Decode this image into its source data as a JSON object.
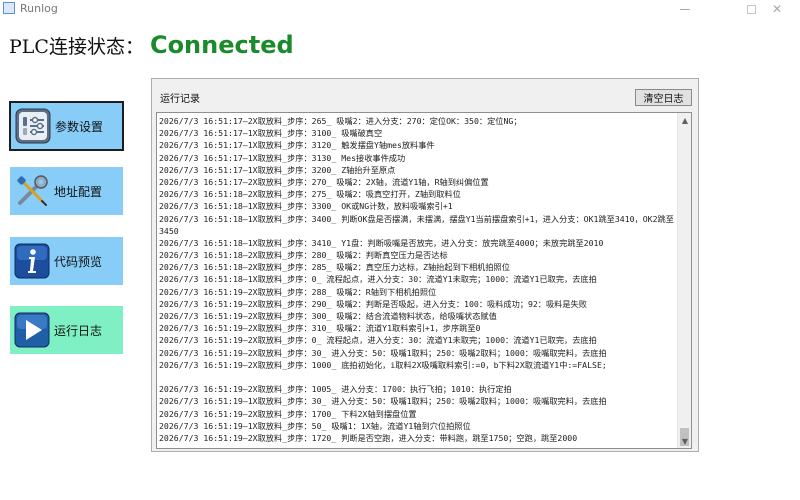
{
  "window": {
    "title": "Runlog",
    "minimize_glyph": "minimize-icon",
    "maximize_glyph": "maximize-icon",
    "close_glyph": "✕"
  },
  "plc": {
    "label": "PLC连接状态：",
    "status": "Connected",
    "status_color": "#1a8a2a"
  },
  "sidebar": {
    "items": [
      {
        "label": "参数设置",
        "icon": "settings-sliders-icon",
        "color": "#87cdf7",
        "active": true
      },
      {
        "label": "地址配置",
        "icon": "wrench-screwdriver-icon",
        "color": "#87cdf7",
        "active": false
      },
      {
        "label": "代码预览",
        "icon": "info-icon",
        "color": "#87cdf7",
        "active": false
      },
      {
        "label": "运行日志",
        "icon": "play-icon",
        "color": "#7ff0c4",
        "active": false
      }
    ]
  },
  "log": {
    "title": "运行记录",
    "clear_button": "清空日志",
    "scroll_up": "▲",
    "scroll_down": "▼",
    "lines": [
      "2026/7/3 16:51:17—2X取放料_步序：265_ 吸嘴2：进入分支：270：定位OK：350：定位NG；",
      "2026/7/3 16:51:17—1X取放料_步序：3100_ 吸嘴破真空",
      "2026/7/3 16:51:17—1X取放料_步序：3120_ 触发摆盘Y轴mes放料事件",
      "2026/7/3 16:51:17—1X取放料_步序：3130_ Mes接收事件成功",
      "2026/7/3 16:51:17—1X取放料_步序：3200_ Z轴抬升至原点",
      "2026/7/3 16:51:17—2X取放料_步序：270_ 吸嘴2：2X轴，流道Y1轴，R轴到纠偏位置",
      "2026/7/3 16:51:18—2X取放料_步序：275_ 吸嘴2：吸真空打开，Z轴到取料位",
      "2026/7/3 16:51:18—1X取放料_步序：3300_ OK或NG计数，放料吸嘴索引+1",
      "2026/7/3 16:51:18—1X取放料_步序：3400_ 判断OK盘是否摆满，未摆满，摆盘Y1当前摆盘索引+1，进入分支：OK1跳至3410，OK2跳至3450",
      "2026/7/3 16:51:18—1X取放料_步序：3410_ Y1盘：判断吸嘴是否放完，进入分支：放完跳至4000；未放完跳至2010",
      "2026/7/3 16:51:18—2X取放料_步序：280_ 吸嘴2：判断真空压力是否达标",
      "2026/7/3 16:51:18—2X取放料_步序：285_ 吸嘴2：真空压力达标，Z轴抬起到下相机拍照位",
      "2026/7/3 16:51:18—1X取放料_步序：0_ 流程起点，进入分支：30：流道Y1未取完；1000：流道Y1已取完，去底拍",
      "2026/7/3 16:51:19—2X取放料_步序：288_ 吸嘴2：R轴到下相机拍照位",
      "2026/7/3 16:51:19—2X取放料_步序：290_ 吸嘴2：判断是否吸起，进入分支：100：吸料成功；92：吸料是失败",
      "2026/7/3 16:51:19—2X取放料_步序：300_ 吸嘴2：结合流道物料状态，给吸嘴状态赋值",
      "2026/7/3 16:51:19—2X取放料_步序：310_ 吸嘴2：流道Y1取料索引+1，步序跳至0",
      "2026/7/3 16:51:19—2X取放料_步序：0_ 流程起点，进入分支：30：流道Y1未取完；1000：流道Y1已取完，去底拍",
      "2026/7/3 16:51:19—2X取放料_步序：30_ 进入分支：50：吸嘴1取料；250：吸嘴2取料；1000：吸嘴取完料，去底拍",
      "2026/7/3 16:51:19—2X取放料_步序：1000_ 底拍初始化，i取料2X吸嘴取料索引:=0，b下料2X取流道Y1中:=FALSE;",
      "2026/7/3 16:51:19—2X取放料_步序：1005_ 进入分支：1700：执行飞拍；1010：执行定拍",
      "2026/7/3 16:51:19—1X取放料_步序：30_ 进入分支：50：吸嘴1取料；250：吸嘴2取料；1000：吸嘴取完料，去底拍",
      "2026/7/3 16:51:19—2X取放料_步序：1700_ 下料2X轴到摆盘位置",
      "2026/7/3 16:51:19—1X取放料_步序：50_ 吸嘴1：1X轴，流道Y1轴到穴位拍照位",
      "2026/7/3 16:51:19—2X取放料_步序：1720_ 判断是否空跑，进入分支：带料跑，跳至1750；空跑，跳至2000"
    ]
  }
}
